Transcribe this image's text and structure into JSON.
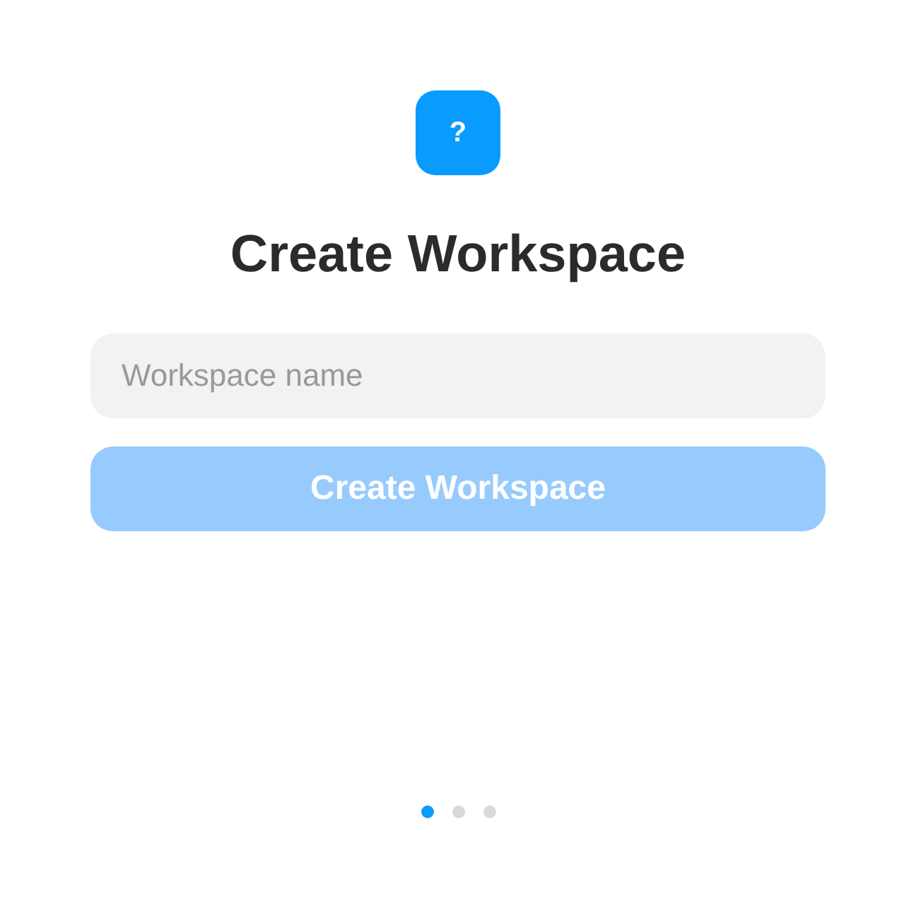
{
  "logo": {
    "symbol": "?"
  },
  "title": "Create Workspace",
  "name_field": {
    "placeholder": "Workspace name"
  },
  "create_button": {
    "label": "Create Workspace",
    "disabled": true
  },
  "pager": [
    {
      "selected": true
    },
    {
      "selected": false
    },
    {
      "selected": false
    }
  ]
}
